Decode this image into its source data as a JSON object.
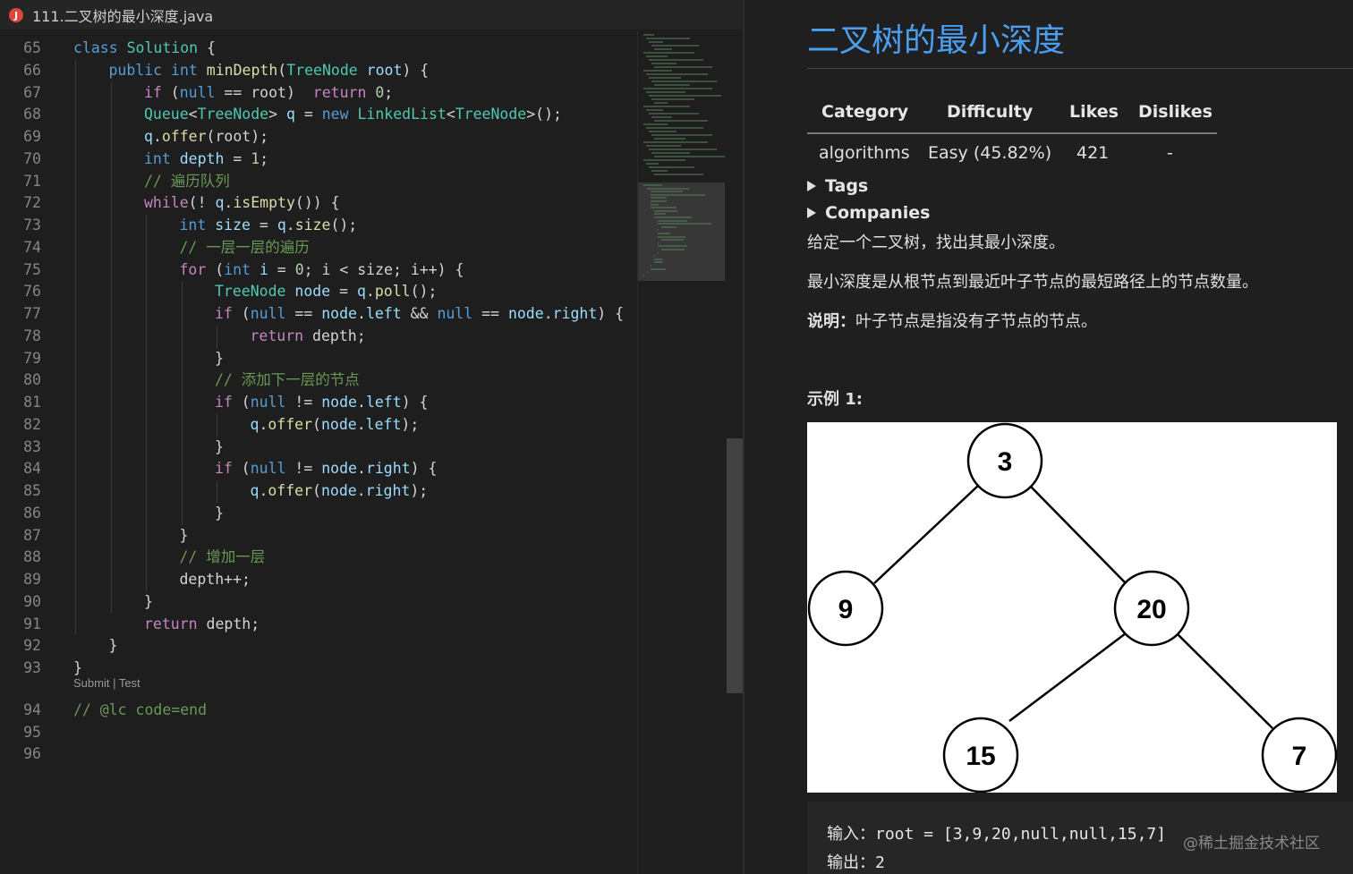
{
  "editor": {
    "tab_title": "111.二叉树的最小深度.java",
    "tab_icon_letter": "J",
    "lines": [
      {
        "n": "65",
        "indent": 0,
        "tokens": [
          [
            "kw",
            "class"
          ],
          [
            "pl",
            " "
          ],
          [
            "ty",
            "Solution"
          ],
          [
            "pl",
            " {"
          ]
        ]
      },
      {
        "n": "66",
        "indent": 1,
        "tokens": [
          [
            "kw",
            "public"
          ],
          [
            "pl",
            " "
          ],
          [
            "kw",
            "int"
          ],
          [
            "pl",
            " "
          ],
          [
            "fn",
            "minDepth"
          ],
          [
            "pl",
            "("
          ],
          [
            "ty",
            "TreeNode"
          ],
          [
            "pl",
            " "
          ],
          [
            "var",
            "root"
          ],
          [
            "pl",
            ") {"
          ]
        ]
      },
      {
        "n": "67",
        "indent": 2,
        "tokens": [
          [
            "ctl",
            "if"
          ],
          [
            "pl",
            " ("
          ],
          [
            "kw",
            "null"
          ],
          [
            "pl",
            " == root)  "
          ],
          [
            "ctl",
            "return"
          ],
          [
            "pl",
            " "
          ],
          [
            "num",
            "0"
          ],
          [
            "pl",
            ";"
          ]
        ]
      },
      {
        "n": "68",
        "indent": 2,
        "tokens": [
          [
            "ty",
            "Queue"
          ],
          [
            "pl",
            "<"
          ],
          [
            "ty",
            "TreeNode"
          ],
          [
            "pl",
            "> "
          ],
          [
            "var",
            "q"
          ],
          [
            "pl",
            " = "
          ],
          [
            "kw",
            "new"
          ],
          [
            "pl",
            " "
          ],
          [
            "ty",
            "LinkedList"
          ],
          [
            "pl",
            "<"
          ],
          [
            "ty",
            "TreeNode"
          ],
          [
            "pl",
            ">();"
          ]
        ]
      },
      {
        "n": "69",
        "indent": 2,
        "tokens": [
          [
            "var",
            "q"
          ],
          [
            "pl",
            "."
          ],
          [
            "fn",
            "offer"
          ],
          [
            "pl",
            "(root);"
          ]
        ]
      },
      {
        "n": "70",
        "indent": 2,
        "tokens": [
          [
            "kw",
            "int"
          ],
          [
            "pl",
            " "
          ],
          [
            "var",
            "depth"
          ],
          [
            "pl",
            " = "
          ],
          [
            "num",
            "1"
          ],
          [
            "pl",
            ";"
          ]
        ]
      },
      {
        "n": "71",
        "indent": 2,
        "tokens": [
          [
            "cm",
            "// 遍历队列"
          ]
        ]
      },
      {
        "n": "72",
        "indent": 2,
        "tokens": [
          [
            "ctl",
            "while"
          ],
          [
            "pl",
            "(! "
          ],
          [
            "var",
            "q"
          ],
          [
            "pl",
            "."
          ],
          [
            "fn",
            "isEmpty"
          ],
          [
            "pl",
            "()) {"
          ]
        ]
      },
      {
        "n": "73",
        "indent": 3,
        "tokens": [
          [
            "kw",
            "int"
          ],
          [
            "pl",
            " "
          ],
          [
            "var",
            "size"
          ],
          [
            "pl",
            " = "
          ],
          [
            "var",
            "q"
          ],
          [
            "pl",
            "."
          ],
          [
            "fn",
            "size"
          ],
          [
            "pl",
            "();"
          ]
        ]
      },
      {
        "n": "74",
        "indent": 3,
        "tokens": [
          [
            "cm",
            "// 一层一层的遍历"
          ]
        ]
      },
      {
        "n": "75",
        "indent": 3,
        "tokens": [
          [
            "ctl",
            "for"
          ],
          [
            "pl",
            " ("
          ],
          [
            "kw",
            "int"
          ],
          [
            "pl",
            " "
          ],
          [
            "var",
            "i"
          ],
          [
            "pl",
            " = "
          ],
          [
            "num",
            "0"
          ],
          [
            "pl",
            "; i < size; i++) {"
          ]
        ]
      },
      {
        "n": "76",
        "indent": 4,
        "tokens": [
          [
            "ty",
            "TreeNode"
          ],
          [
            "pl",
            " "
          ],
          [
            "var",
            "node"
          ],
          [
            "pl",
            " = "
          ],
          [
            "var",
            "q"
          ],
          [
            "pl",
            "."
          ],
          [
            "fn",
            "poll"
          ],
          [
            "pl",
            "();"
          ]
        ]
      },
      {
        "n": "77",
        "indent": 4,
        "tokens": [
          [
            "ctl",
            "if"
          ],
          [
            "pl",
            " ("
          ],
          [
            "kw",
            "null"
          ],
          [
            "pl",
            " == "
          ],
          [
            "var",
            "node"
          ],
          [
            "pl",
            "."
          ],
          [
            "var",
            "left"
          ],
          [
            "pl",
            " && "
          ],
          [
            "kw",
            "null"
          ],
          [
            "pl",
            " == "
          ],
          [
            "var",
            "node"
          ],
          [
            "pl",
            "."
          ],
          [
            "var",
            "right"
          ],
          [
            "pl",
            ") {"
          ]
        ]
      },
      {
        "n": "78",
        "indent": 5,
        "tokens": [
          [
            "ctl",
            "return"
          ],
          [
            "pl",
            " depth;"
          ]
        ]
      },
      {
        "n": "79",
        "indent": 4,
        "tokens": [
          [
            "pl",
            "}"
          ]
        ]
      },
      {
        "n": "80",
        "indent": 4,
        "tokens": [
          [
            "cm",
            "// 添加下一层的节点"
          ]
        ]
      },
      {
        "n": "81",
        "indent": 4,
        "tokens": [
          [
            "ctl",
            "if"
          ],
          [
            "pl",
            " ("
          ],
          [
            "kw",
            "null"
          ],
          [
            "pl",
            " != "
          ],
          [
            "var",
            "node"
          ],
          [
            "pl",
            "."
          ],
          [
            "var",
            "left"
          ],
          [
            "pl",
            ") {"
          ]
        ]
      },
      {
        "n": "82",
        "indent": 5,
        "tokens": [
          [
            "var",
            "q"
          ],
          [
            "pl",
            "."
          ],
          [
            "fn",
            "offer"
          ],
          [
            "pl",
            "("
          ],
          [
            "var",
            "node"
          ],
          [
            "pl",
            "."
          ],
          [
            "var",
            "left"
          ],
          [
            "pl",
            ");"
          ]
        ]
      },
      {
        "n": "83",
        "indent": 4,
        "tokens": [
          [
            "pl",
            "}"
          ]
        ]
      },
      {
        "n": "84",
        "indent": 4,
        "tokens": [
          [
            "ctl",
            "if"
          ],
          [
            "pl",
            " ("
          ],
          [
            "kw",
            "null"
          ],
          [
            "pl",
            " != "
          ],
          [
            "var",
            "node"
          ],
          [
            "pl",
            "."
          ],
          [
            "var",
            "right"
          ],
          [
            "pl",
            ") {"
          ]
        ]
      },
      {
        "n": "85",
        "indent": 5,
        "tokens": [
          [
            "var",
            "q"
          ],
          [
            "pl",
            "."
          ],
          [
            "fn",
            "offer"
          ],
          [
            "pl",
            "("
          ],
          [
            "var",
            "node"
          ],
          [
            "pl",
            "."
          ],
          [
            "var",
            "right"
          ],
          [
            "pl",
            ");"
          ]
        ]
      },
      {
        "n": "86",
        "indent": 4,
        "tokens": [
          [
            "pl",
            "}"
          ]
        ]
      },
      {
        "n": "87",
        "indent": 3,
        "tokens": [
          [
            "pl",
            "}"
          ]
        ]
      },
      {
        "n": "88",
        "indent": 3,
        "tokens": [
          [
            "cm",
            "// 增加一层"
          ]
        ]
      },
      {
        "n": "89",
        "indent": 3,
        "tokens": [
          [
            "pl",
            "depth++;"
          ]
        ]
      },
      {
        "n": "90",
        "indent": 2,
        "tokens": [
          [
            "pl",
            "}"
          ]
        ]
      },
      {
        "n": "91",
        "indent": 2,
        "tokens": [
          [
            "ctl",
            "return"
          ],
          [
            "pl",
            " depth;"
          ]
        ]
      },
      {
        "n": "92",
        "indent": 1,
        "tokens": [
          [
            "pl",
            "}"
          ]
        ]
      },
      {
        "n": "93",
        "indent": 0,
        "tokens": [
          [
            "pl",
            "}"
          ]
        ]
      }
    ],
    "code_lens": "Submit | Test",
    "tail_lines": [
      {
        "n": "94",
        "tokens": [
          [
            "cm",
            "// @lc code=end"
          ]
        ]
      },
      {
        "n": "95",
        "tokens": []
      },
      {
        "n": "96",
        "tokens": []
      }
    ]
  },
  "preview": {
    "title": "二叉树的最小深度",
    "table": {
      "headers": [
        "Category",
        "Difficulty",
        "Likes",
        "Dislikes"
      ],
      "row": [
        "algorithms",
        "Easy (45.82%)",
        "421",
        "-"
      ]
    },
    "tags_label": "Tags",
    "companies_label": "Companies",
    "description": "给定一个二叉树，找出其最小深度。",
    "definition": "最小深度是从根节点到最近叶子节点的最短路径上的节点数量。",
    "note_label": "说明：",
    "note_text": "叶子节点是指没有子节点的节点。",
    "example_label": "示例 1:",
    "tree_nodes": [
      "3",
      "9",
      "20",
      "15",
      "7"
    ],
    "input_line": "输入：root = [3,9,20,null,null,15,7]",
    "output_line": "输出：2",
    "watermark": "@稀土掘金技术社区"
  },
  "colors": {
    "title_blue": "#4a9ff0",
    "keyword": "#569cd6",
    "control": "#c586c0",
    "type": "#4ec9b0",
    "function": "#dcdcaa",
    "variable": "#9cdcfe",
    "number": "#b5cea8",
    "comment": "#6a9955"
  }
}
